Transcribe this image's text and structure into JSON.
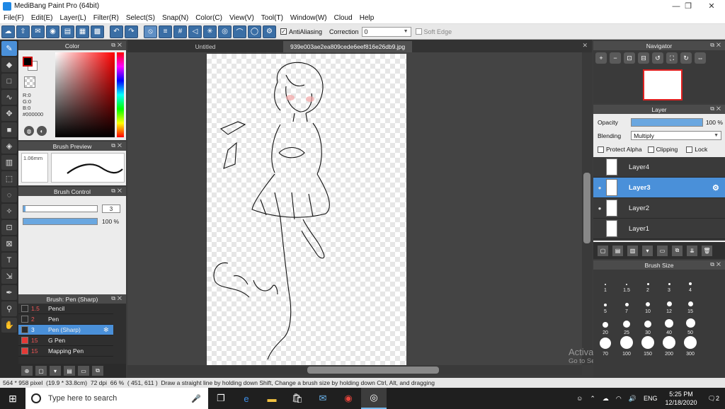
{
  "window": {
    "title": "MediBang Paint Pro (64bit)",
    "minimize": "—",
    "maximize": "❐",
    "close": "✕"
  },
  "menu": [
    "File(F)",
    "Edit(E)",
    "Layer(L)",
    "Filter(R)",
    "Select(S)",
    "Snap(N)",
    "Color(C)",
    "View(V)",
    "Tool(T)",
    "Window(W)",
    "Cloud",
    "Help"
  ],
  "toolbar": {
    "antialiasing_label": "AntiAliasing",
    "antialiasing_checked": "✓",
    "correction_label": "Correction",
    "correction_value": "0",
    "soft_edge_label": "Soft Edge"
  },
  "color_panel": {
    "title": "Color",
    "r": "R:0",
    "g": "G:0",
    "b": "B:0",
    "hex": "#000000",
    "fg_color": "#000000",
    "bg_color": "#ffffff"
  },
  "brush_preview": {
    "title": "Brush Preview",
    "size": "1.06mm"
  },
  "brush_control": {
    "title": "Brush Control",
    "size_value": "3",
    "opacity_value": "100 %",
    "size_fraction": 1.0,
    "opacity_fraction": 1.0
  },
  "brush_list": {
    "title": "Brush: Pen (Sharp)",
    "items": [
      {
        "size": "1.5",
        "name": "Pencil",
        "color": "#2b2b2b"
      },
      {
        "size": "2",
        "name": "Pen",
        "color": "#2b2b2b"
      },
      {
        "size": "3",
        "name": "Pen (Sharp)",
        "color": "#2b2b2b",
        "active": true
      },
      {
        "size": "15",
        "name": "G Pen",
        "color": "#e53935"
      },
      {
        "size": "15",
        "name": "Mapping Pen",
        "color": "#e53935"
      }
    ]
  },
  "tabs": [
    {
      "label": "Untitled"
    },
    {
      "label": "939e003ae2ea809cede6eef816e26db9.jpg",
      "active": true
    }
  ],
  "tab_close": "✕",
  "navigator": {
    "title": "Navigator"
  },
  "layer_panel": {
    "title": "Layer",
    "opacity_label": "Opacity",
    "opacity_value": "100 %",
    "opacity_fraction": 1.0,
    "blending_label": "Blending",
    "blending_value": "Multiply",
    "protect_alpha": "Protect Alpha",
    "clipping": "Clipping",
    "lock": "Lock",
    "layers": [
      {
        "name": "Layer4",
        "visible": false
      },
      {
        "name": "Layer3",
        "visible": true,
        "active": true
      },
      {
        "name": "Layer2",
        "visible": true
      },
      {
        "name": "Layer1",
        "visible": false
      }
    ]
  },
  "brush_size": {
    "title": "Brush Size",
    "sizes": [
      "1",
      "1.5",
      "2",
      "3",
      "4",
      "5",
      "7",
      "10",
      "12",
      "15",
      "20",
      "25",
      "30",
      "40",
      "50",
      "70",
      "100",
      "150",
      "200",
      "300"
    ]
  },
  "watermark": {
    "line1": "Activate Windows",
    "line2": "Go to Settings to activate Windows."
  },
  "status": {
    "dimensions": "564 * 958 pixel",
    "physical": "(19.9 * 33.8cm)",
    "dpi": "72 dpi",
    "zoom": "66 %",
    "coords": "( 451, 611 )",
    "hint": "Draw a straight line by holding down Shift, Change a brush size by holding down Ctrl, Alt, and dragging"
  },
  "taskbar": {
    "search_placeholder": "Type here to search",
    "lang": "ENG",
    "time": "5:25 PM",
    "date": "12/18/2020",
    "notifications": "2"
  }
}
